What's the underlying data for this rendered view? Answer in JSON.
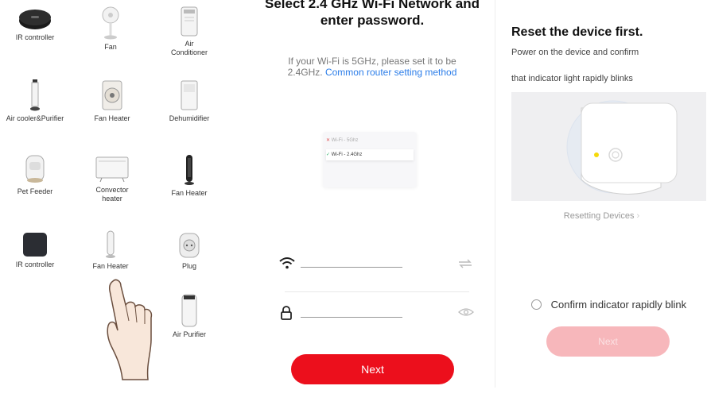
{
  "devices": [
    {
      "label": "IR controller"
    },
    {
      "label": "Fan"
    },
    {
      "label": "Air\nConditioner"
    },
    {
      "label": "Air cooler&Purifier"
    },
    {
      "label": "Fan Heater"
    },
    {
      "label": "Dehumidifier"
    },
    {
      "label": "Pet Feeder"
    },
    {
      "label": "Convector\nheater"
    },
    {
      "label": "Fan Heater"
    },
    {
      "label": "IR controller"
    },
    {
      "label": "Fan Heater"
    },
    {
      "label": "Plug"
    },
    {
      "label": "Air Purifier"
    }
  ],
  "wifi_screen": {
    "title": "Select 2.4 GHz Wi-Fi Network and enter password.",
    "hint": "If your Wi-Fi is 5GHz, please set it to be 2.4GHz.",
    "hint_link": "Common router setting method",
    "wifi_5g": "Wi-Fi - 5Ghz",
    "wifi_24g": "Wi-Fi - 2.4Ghz",
    "ssid_value": "",
    "password_value": "",
    "next_label": "Next"
  },
  "reset_screen": {
    "title": "Reset the device first.",
    "line1": "Power on the device and confirm",
    "line2": "that indicator light rapidly blinks",
    "resetting_link": "Resetting Devices",
    "confirm_label": "Confirm indicator rapidly blink",
    "next_label": "Next"
  },
  "colors": {
    "accent": "#ec0f1c",
    "accent_disabled": "#f7b7bb",
    "link": "#2b7de9",
    "indicator": "#f5d90a"
  }
}
